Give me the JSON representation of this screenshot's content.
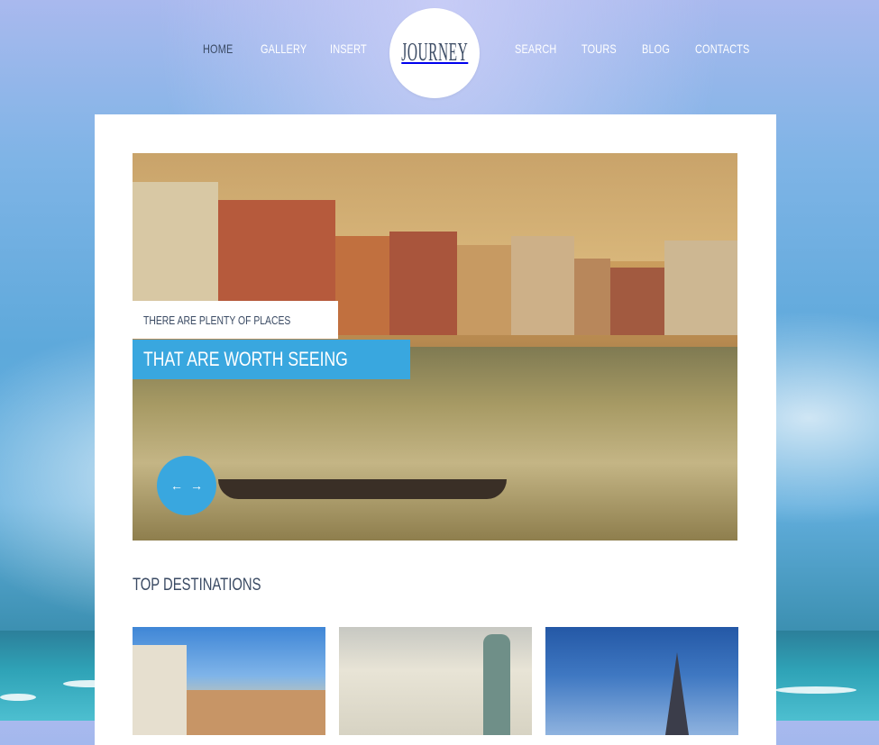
{
  "nav": {
    "items": [
      {
        "label": "HOME",
        "active": true
      },
      {
        "label": "GALLERY",
        "active": false
      },
      {
        "label": "INSERT",
        "active": false
      },
      {
        "label": "SEARCH",
        "active": false
      },
      {
        "label": "TOURS",
        "active": false
      },
      {
        "label": "BLOG",
        "active": false
      },
      {
        "label": "CONTACTS",
        "active": false
      }
    ]
  },
  "logo": {
    "text": "JOURNEY"
  },
  "slider": {
    "caption_line1": "THERE ARE PLENTY OF PLACES",
    "caption_line2": "THAT ARE WORTH SEEING",
    "prev_icon": "arrow-left-icon",
    "next_icon": "arrow-right-icon"
  },
  "section": {
    "title": "TOP DESTINATIONS"
  },
  "destinations": [
    {
      "image": "venice-destination"
    },
    {
      "image": "statue-of-liberty-destination"
    },
    {
      "image": "eiffel-tower-destination"
    }
  ],
  "colors": {
    "accent": "#39a7df",
    "text": "#3a4a63",
    "nav_text": "#ffffff"
  }
}
